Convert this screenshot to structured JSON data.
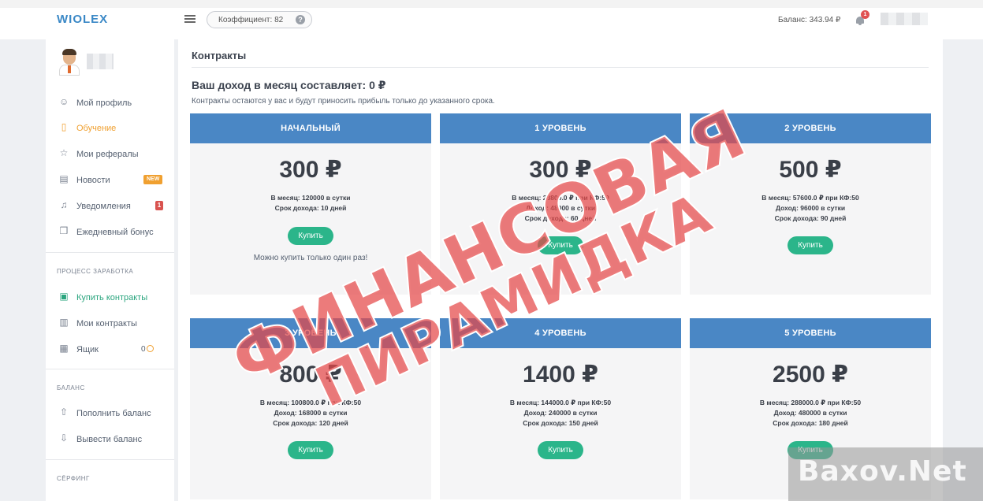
{
  "topbar": {
    "brand": "WIOLEX",
    "coefficient": "Коэффициент: 82",
    "balance": "Баланс: 343.94 ₽",
    "notifications_count": "1"
  },
  "sidebar": {
    "menu": [
      {
        "label": "Мой профиль",
        "icon": "user-icon"
      },
      {
        "label": "Обучение",
        "icon": "bookmark-icon"
      },
      {
        "label": "Мои рефералы",
        "icon": "star-icon"
      },
      {
        "label": "Новости",
        "icon": "news-icon",
        "badge": "NEW"
      },
      {
        "label": "Уведомления",
        "icon": "bell-icon",
        "badge": "1"
      },
      {
        "label": "Ежедневный бонус",
        "icon": "gift-icon"
      }
    ],
    "section_earn": "ПРОЦЕСС ЗАРАБОТКА",
    "earn_items": [
      {
        "label": "Купить контракты",
        "icon": "cart-icon"
      },
      {
        "label": "Мои контракты",
        "icon": "contracts-icon"
      },
      {
        "label": "Ящик",
        "icon": "box-icon",
        "count": "0"
      }
    ],
    "section_balance": "БАЛАНС",
    "balance_items": [
      {
        "label": "Пополнить баланс",
        "icon": "upload-icon"
      },
      {
        "label": "Вывести баланс",
        "icon": "download-icon"
      }
    ],
    "section_surf": "СЁРФИНГ"
  },
  "main": {
    "title": "Контракты",
    "income": "Ваш доход в месяц составляет: 0 ₽",
    "note": "Контракты остаются у вас и будут приносить прибыль только до указанного срока.",
    "buy_label": "Купить",
    "once_note": "Можно купить только один раз!",
    "cards": [
      {
        "name": "НАЧАЛЬНЫЙ",
        "price": "300 ₽",
        "line1": "В месяц: 120000 в сутки",
        "line2": "Срок дохода: 10 дней",
        "line3": ""
      },
      {
        "name": "1 УРОВЕНЬ",
        "price": "300 ₽",
        "line1": "В месяц: 28800.0 ₽ при КФ:50",
        "line2": "Доход: 48000 в сутки",
        "line3": "Срок дохода: 60 дней"
      },
      {
        "name": "2 УРОВЕНЬ",
        "price": "500 ₽",
        "line1": "В месяц: 57600.0 ₽ при КФ:50",
        "line2": "Доход: 96000 в сутки",
        "line3": "Срок дохода: 90 дней"
      },
      {
        "name": "3 УРОВЕНЬ",
        "price": "800 ₽",
        "line1": "В месяц: 100800.0 ₽ при КФ:50",
        "line2": "Доход: 168000 в сутки",
        "line3": "Срок дохода: 120 дней"
      },
      {
        "name": "4 УРОВЕНЬ",
        "price": "1400 ₽",
        "line1": "В месяц: 144000.0 ₽ при КФ:50",
        "line2": "Доход: 240000 в сутки",
        "line3": "Срок дохода: 150 дней"
      },
      {
        "name": "5 УРОВЕНЬ",
        "price": "2500 ₽",
        "line1": "В месяц: 288000.0 ₽ при КФ:50",
        "line2": "Доход: 480000 в сутки",
        "line3": "Срок дохода: 180 дней"
      }
    ]
  },
  "stamp": {
    "line1": "ФИНАНСОВАЯ",
    "line2": "ПИРАМИДКА"
  },
  "watermark": "Baxov.Net",
  "colors": {
    "header_blue": "#4a87c5",
    "buy_green": "#2bb58a",
    "accent_orange": "#f0a030",
    "stamp_red": "#e44848"
  }
}
